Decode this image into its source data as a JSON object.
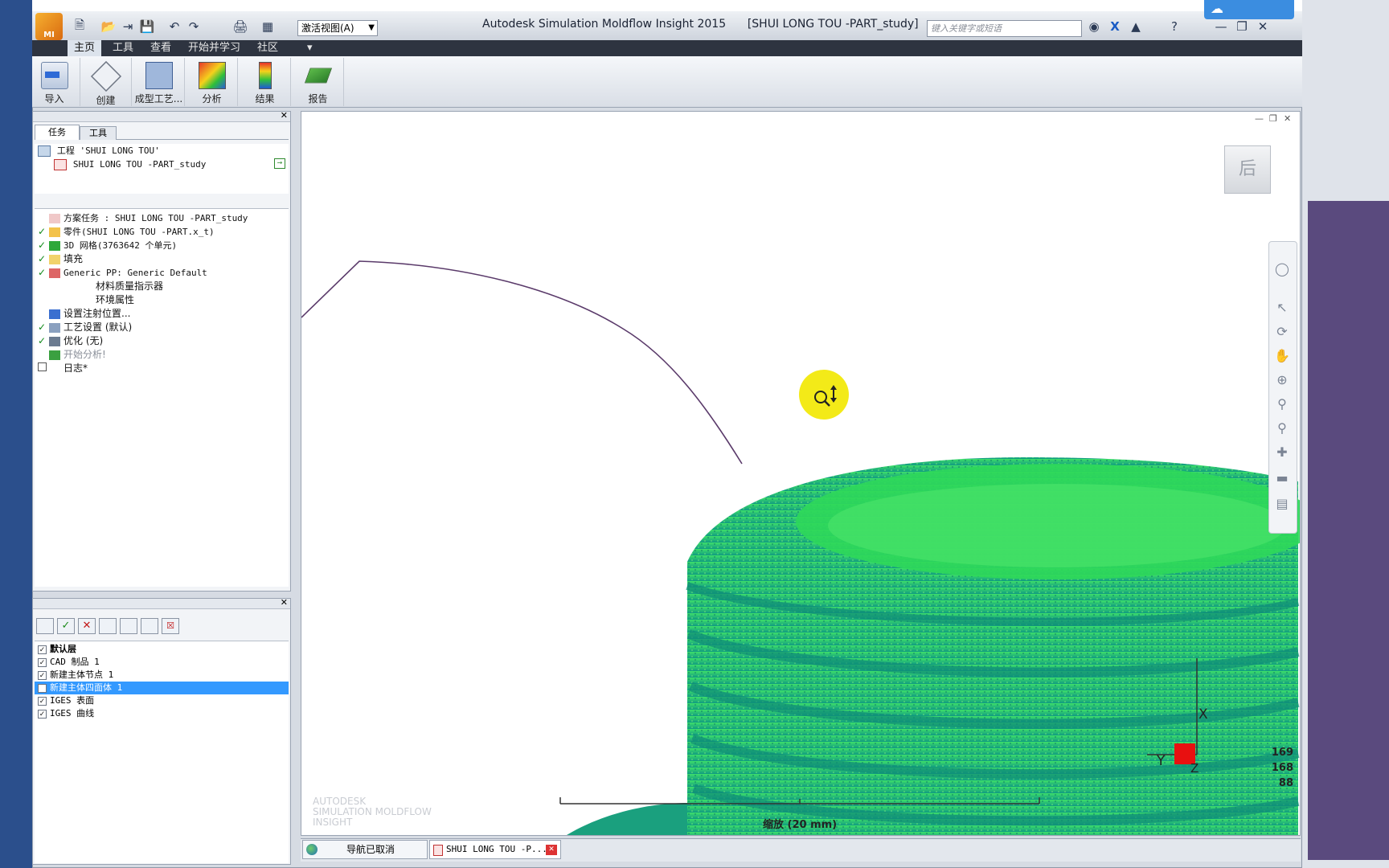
{
  "app": {
    "title": "Autodesk Simulation Moldflow Insight 2015",
    "document": "[SHUI LONG TOU -PART_study]"
  },
  "quick_access": {
    "view_select": "激活视图(A)",
    "search_placeholder": "键入关键字或短语"
  },
  "tabs": [
    {
      "label": "主页",
      "active": true
    },
    {
      "label": "工具",
      "active": false
    },
    {
      "label": "查看",
      "active": false
    },
    {
      "label": "开始并学习",
      "active": false
    },
    {
      "label": "社区",
      "active": false
    }
  ],
  "ribbon": [
    {
      "label": "导入",
      "icon": "import-icon"
    },
    {
      "label": "创建",
      "icon": "create-icon"
    },
    {
      "label": "成型工艺...",
      "icon": "molding-process-icon"
    },
    {
      "label": "分析",
      "icon": "analysis-icon"
    },
    {
      "label": "结果",
      "icon": "results-icon"
    },
    {
      "label": "报告",
      "icon": "report-icon"
    }
  ],
  "task_panel": {
    "tabs": [
      "任务",
      "工具"
    ],
    "project": "工程 'SHUI LONG TOU'",
    "study": "SHUI LONG TOU -PART_study",
    "tasks": [
      {
        "label": "方案任务 : SHUI LONG TOU -PART_study",
        "checked": false,
        "indent": 0
      },
      {
        "label": "零件(SHUI LONG TOU -PART.x_t)",
        "checked": true,
        "indent": 0
      },
      {
        "label": "3D 网格(3763642 个单元)",
        "checked": true,
        "indent": 0
      },
      {
        "label": "填充",
        "checked": true,
        "indent": 0
      },
      {
        "label": "Generic PP: Generic Default",
        "checked": true,
        "indent": 0
      },
      {
        "label": "材料质量指示器",
        "checked": false,
        "indent": 2
      },
      {
        "label": "环境属性",
        "checked": false,
        "indent": 2
      },
      {
        "label": "设置注射位置...",
        "checked": false,
        "indent": 0
      },
      {
        "label": "工艺设置 (默认)",
        "checked": true,
        "indent": 0
      },
      {
        "label": "优化 (无)",
        "checked": true,
        "indent": 0
      },
      {
        "label": "开始分析!",
        "checked": false,
        "indent": 0
      },
      {
        "label": "日志*",
        "checked": false,
        "indent": 0,
        "box": true
      }
    ]
  },
  "layers": [
    {
      "label": "默认层",
      "checked": true,
      "selected": false
    },
    {
      "label": "CAD 制品 1",
      "checked": true,
      "selected": false
    },
    {
      "label": "新建主体节点 1",
      "checked": true,
      "selected": false
    },
    {
      "label": "新建主体四面体 1",
      "checked": false,
      "selected": true
    },
    {
      "label": "IGES 表面",
      "checked": true,
      "selected": false
    },
    {
      "label": "IGES 曲线",
      "checked": true,
      "selected": false
    }
  ],
  "viewport": {
    "watermark": [
      "AUTODESK",
      "SIMULATION MOLDFLOW",
      "INSIGHT"
    ],
    "scale_label": "缩放 (20 mm)",
    "axis_x": "X",
    "axis_y": "Y",
    "axis_z": "Z",
    "readout": [
      "169",
      "168",
      "88"
    ],
    "viewcube_label": "后",
    "colors": {
      "mesh_light": "#3ee066",
      "mesh_dark": "#12a58a",
      "cursor": "#f3ea18"
    }
  },
  "status_tabs": [
    {
      "label": "导航已取消"
    },
    {
      "label": "SHUI LONG TOU -P..."
    }
  ]
}
